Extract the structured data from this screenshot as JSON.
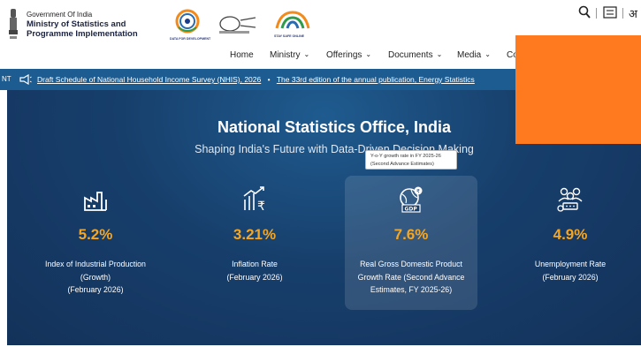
{
  "header": {
    "org_line1": "Government Of India",
    "org_line2": "Ministry of Statistics and",
    "org_line3": "Programme Implementation",
    "logo_texts": [
      "DATA FOR DEVELOPMENT",
      "STAY SAFE ONLINE"
    ],
    "tools": {
      "search_icon": "search-icon",
      "lang_icon": "language-icon",
      "partial_text": "अ"
    }
  },
  "nav": {
    "items": [
      {
        "label": "Home",
        "has_menu": false
      },
      {
        "label": "Ministry",
        "has_menu": true
      },
      {
        "label": "Offerings",
        "has_menu": true
      },
      {
        "label": "Documents",
        "has_menu": true
      },
      {
        "label": "Media",
        "has_menu": true
      },
      {
        "label": "Co",
        "has_menu": false
      }
    ]
  },
  "ticker": {
    "label": "NT",
    "items": [
      "Draft Schedule of National Household Income Survey (NHIS), 2026",
      "The 33rd edition of the annual publication, Energy Statistics"
    ]
  },
  "hero": {
    "title": "National Statistics Office, India",
    "subtitle": "Shaping India's Future with Data-Driven Decision Making"
  },
  "tooltip": {
    "line1": "Y-o-Y growth rate in FY 2025-26",
    "line2": "(Second Advance Estimates)"
  },
  "stats": [
    {
      "value": "5.2%",
      "label_lines": [
        "Index of Industrial Production",
        "(Growth)",
        "(February 2026)"
      ],
      "icon": "factory-icon"
    },
    {
      "value": "3.21%",
      "label_lines": [
        "Inflation Rate",
        "(February 2026)"
      ],
      "icon": "rupee-growth-icon"
    },
    {
      "value": "7.6%",
      "label_lines": [
        "Real Gross Domestic Product",
        "Growth Rate (Second Advance",
        "Estimates, FY 2025-26)"
      ],
      "icon": "gdp-globe-icon"
    },
    {
      "value": "4.9%",
      "label_lines": [
        "Unemployment Rate",
        "(February 2026)"
      ],
      "icon": "people-group-icon"
    }
  ],
  "colors": {
    "ticker_bg": "#1d5c91",
    "hero_bg": "#173f6c",
    "stat_value": "#f5a623",
    "overlay": "#ff7a1f"
  }
}
